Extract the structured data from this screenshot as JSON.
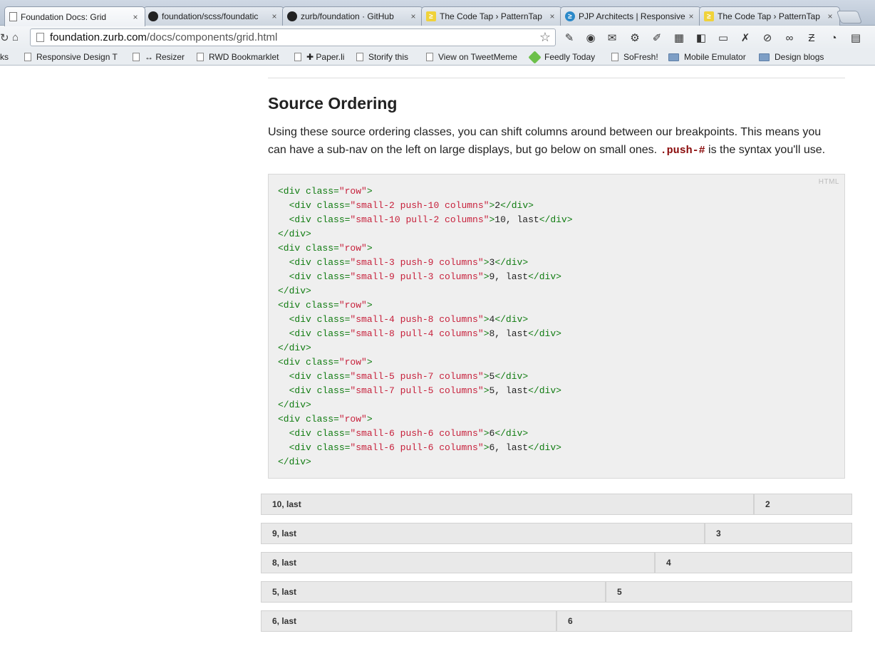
{
  "browser": {
    "tabs": [
      {
        "title": "Foundation Docs: Grid",
        "favicon": "page-icon",
        "active": true
      },
      {
        "title": "foundation/scss/foundatic",
        "favicon": "github-icon",
        "active": false
      },
      {
        "title": "zurb/foundation · GitHub",
        "favicon": "github-icon",
        "active": false
      },
      {
        "title": "The Code Tap › PatternTap",
        "favicon": "codetap-icon",
        "active": false
      },
      {
        "title": "PJP Architects | Responsive",
        "favicon": "pjp-icon",
        "active": false
      },
      {
        "title": "The Code Tap › PatternTap",
        "favicon": "codetap-icon",
        "active": false
      }
    ],
    "url_host": "foundation.zurb.com",
    "url_path": "/docs/components/grid.html",
    "bookmarks": [
      {
        "label": "ks",
        "icon": "none"
      },
      {
        "label": "Responsive Design T",
        "icon": "page"
      },
      {
        "label": "↔ Resizer",
        "icon": "page"
      },
      {
        "label": "RWD Bookmarklet",
        "icon": "page"
      },
      {
        "label": "✚ Paper.li",
        "icon": "page"
      },
      {
        "label": "Storify this",
        "icon": "page"
      },
      {
        "label": "View on TweetMeme",
        "icon": "page"
      },
      {
        "label": "Feedly Today",
        "icon": "feedly"
      },
      {
        "label": "SoFresh!",
        "icon": "page"
      },
      {
        "label": "Mobile Emulator",
        "icon": "folder"
      },
      {
        "label": "Design blogs",
        "icon": "folder"
      }
    ]
  },
  "content": {
    "title": "Source Ordering",
    "intro_text": "Using these source ordering classes, you can shift columns around between our breakpoints. This means you can have a sub-nav on the left on large displays, but go below on small ones.",
    "intro_code": ".push-#",
    "intro_tail": "is the syntax you'll use.",
    "code_language": "HTML",
    "code_rows": [
      {
        "a_class": "small-2 push-10 columns",
        "a_text": "2",
        "b_class": "small-10 pull-2 columns",
        "b_text": "10, last"
      },
      {
        "a_class": "small-3 push-9 columns",
        "a_text": "3",
        "b_class": "small-9 pull-3 columns",
        "b_text": "9, last"
      },
      {
        "a_class": "small-4 push-8 columns",
        "a_text": "4",
        "b_class": "small-8 pull-4 columns",
        "b_text": "8, last"
      },
      {
        "a_class": "small-5 push-7 columns",
        "a_text": "5",
        "b_class": "small-7 pull-5 columns",
        "b_text": "5, last"
      },
      {
        "a_class": "small-6 push-6 columns",
        "a_text": "6",
        "b_class": "small-6 pull-6 columns",
        "b_text": "6, last"
      }
    ],
    "demo_rows": [
      {
        "main_label": "10, last",
        "main_span": 10,
        "side_label": "2",
        "side_span": 2
      },
      {
        "main_label": "9, last",
        "main_span": 9,
        "side_label": "3",
        "side_span": 3
      },
      {
        "main_label": "8, last",
        "main_span": 8,
        "side_label": "4",
        "side_span": 4
      },
      {
        "main_label": "5, last",
        "main_span": 7,
        "side_label": "5",
        "side_span": 5
      },
      {
        "main_label": "6, last",
        "main_span": 6,
        "side_label": "6",
        "side_span": 6
      }
    ]
  }
}
